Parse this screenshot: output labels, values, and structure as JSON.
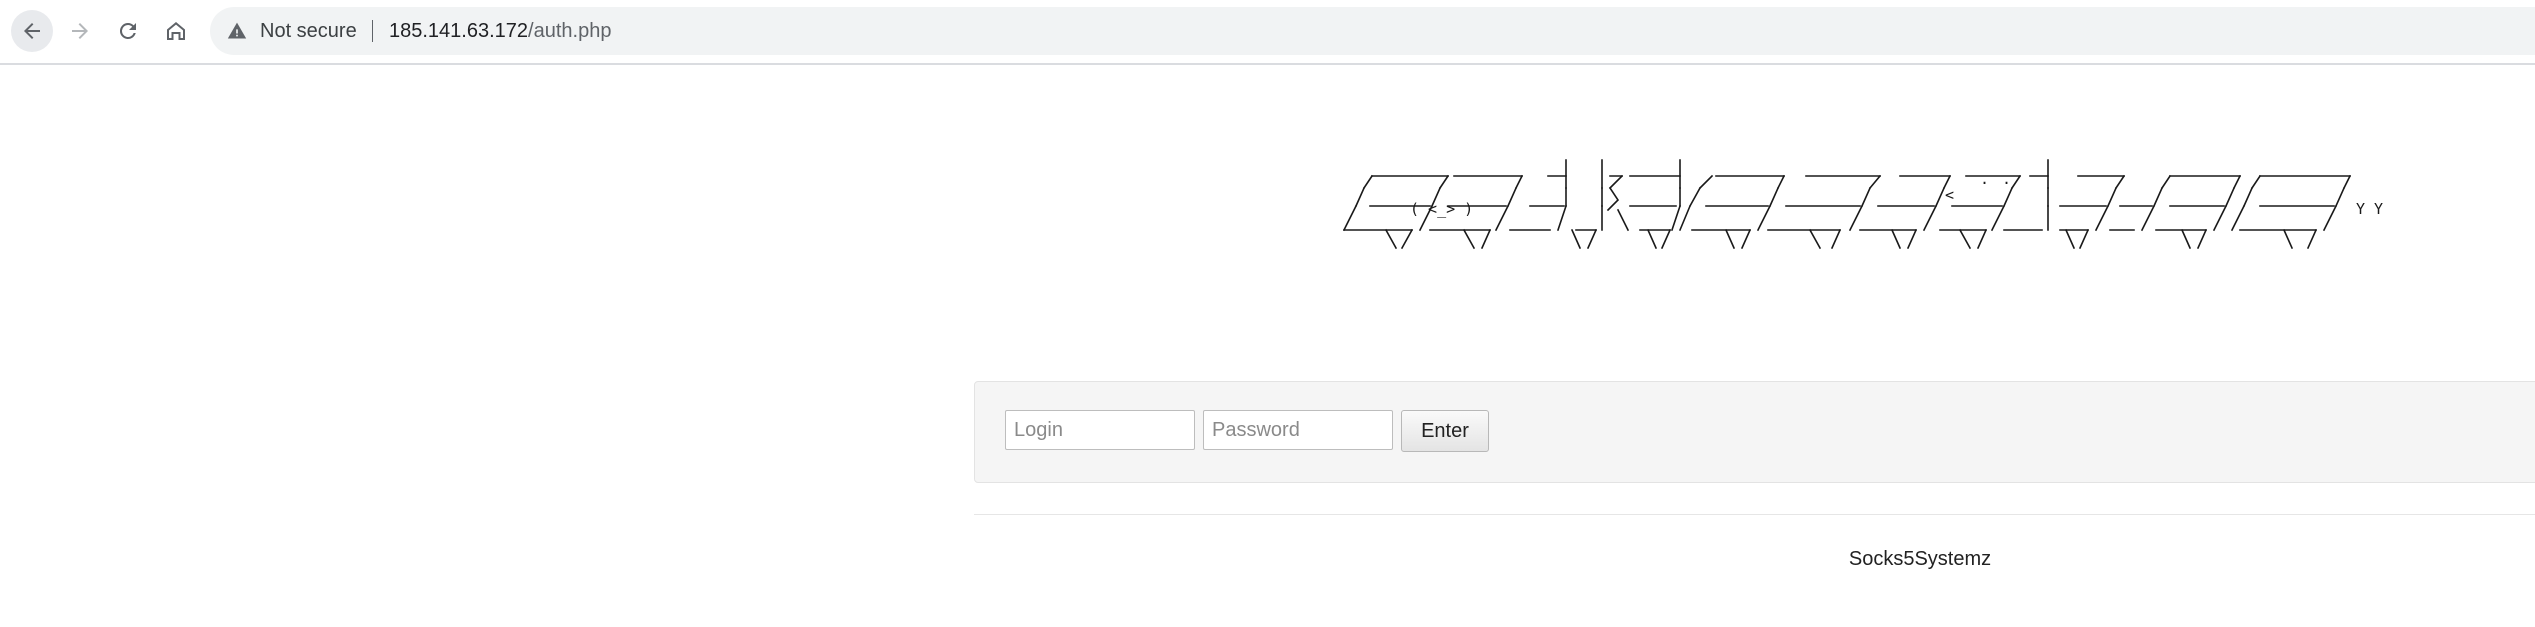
{
  "browser": {
    "security_label": "Not secure",
    "url_host": "185.141.63.172",
    "url_path": "/auth.php",
    "icons": [
      "back-arrow-icon",
      "forward-arrow-icon",
      "reload-icon",
      "home-icon",
      "warning-icon"
    ]
  },
  "banner": {
    "alt": "socks5systemz"
  },
  "login_form": {
    "login_placeholder": "Login",
    "password_placeholder": "Password",
    "submit_label": "Enter"
  },
  "footer": {
    "text": "Socks5Systemz"
  }
}
